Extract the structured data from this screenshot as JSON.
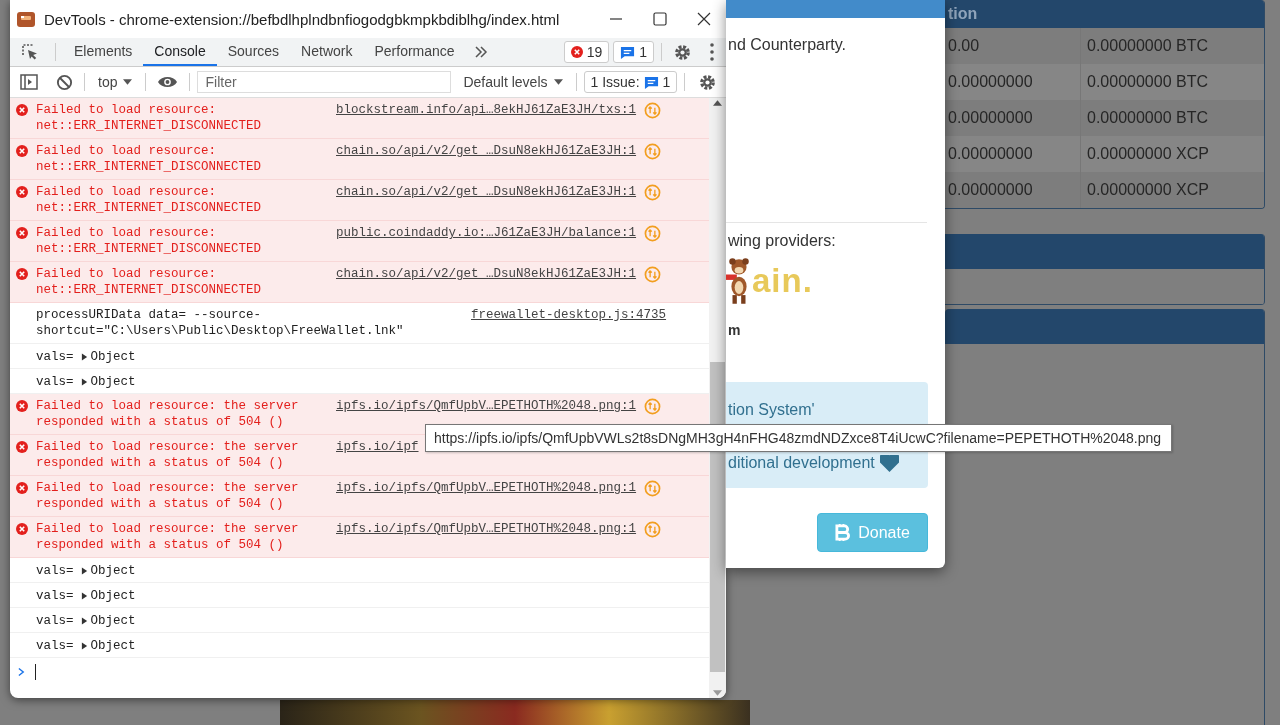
{
  "background": {
    "table": {
      "header": "tion",
      "rows": [
        {
          "amount": "0.00",
          "balance": "0.00000000 BTC"
        },
        {
          "amount": "0.00000000",
          "balance": "0.00000000 BTC"
        },
        {
          "amount": "0.00000000",
          "balance": "0.00000000 BTC"
        },
        {
          "amount": "0.00000000",
          "balance": "0.00000000 XCP"
        },
        {
          "amount": "0.00000000",
          "balance": "0.00000000 XCP"
        }
      ]
    }
  },
  "modal": {
    "intro": "nd Counterparty.",
    "providers_label": "wing providers:",
    "logo_text": "ain.",
    "provider_name": "m",
    "notice_lines": [
      "tion System'",
      "ditional development"
    ],
    "donate": "Donate"
  },
  "devtools": {
    "title": "DevTools - chrome-extension://befbdlhplndbnfiogodgbkmpkbdiblhg/index.html",
    "tabs": [
      {
        "label": "Elements",
        "selected": false
      },
      {
        "label": "Console",
        "selected": true
      },
      {
        "label": "Sources",
        "selected": false
      },
      {
        "label": "Network",
        "selected": false
      },
      {
        "label": "Performance",
        "selected": false
      }
    ],
    "error_count": "19",
    "message_count": "1",
    "context": "top",
    "filter": {
      "placeholder": "Filter"
    },
    "levels": "Default levels",
    "issues": {
      "label": "1 Issue:",
      "count": "1"
    },
    "messages": [
      {
        "kind": "error",
        "text": "Failed to load resource: net::ERR_INTERNET_DISCONNECTED",
        "source": "blockstream.info/api…8ekHJ61ZaE3JH/txs:1",
        "issue_icon": true
      },
      {
        "kind": "error",
        "text": "Failed to load resource: net::ERR_INTERNET_DISCONNECTED",
        "source": "chain.so/api/v2/get_…DsuN8ekHJ61ZaE3JH:1",
        "issue_icon": true
      },
      {
        "kind": "error",
        "text": "Failed to load resource: net::ERR_INTERNET_DISCONNECTED",
        "source": "chain.so/api/v2/get_…DsuN8ekHJ61ZaE3JH:1",
        "issue_icon": true
      },
      {
        "kind": "error",
        "text": "Failed to load resource: net::ERR_INTERNET_DISCONNECTED",
        "source": "public.coindaddy.io:…J61ZaE3JH/balance:1",
        "issue_icon": true
      },
      {
        "kind": "error",
        "text": "Failed to load resource: net::ERR_INTERNET_DISCONNECTED",
        "source": "chain.so/api/v2/get_…DsuN8ekHJ61ZaE3JH:1",
        "issue_icon": true
      },
      {
        "kind": "log",
        "text": "processURIData data= --source-shortcut=\"C:\\Users\\Public\\Desktop\\FreeWallet.lnk\"",
        "source": "freewallet-desktop.js:4735"
      },
      {
        "kind": "object",
        "label": "vals=",
        "value": "Object",
        "expanded": false
      },
      {
        "kind": "object",
        "label": "vals=",
        "value": "Object",
        "expanded": false
      },
      {
        "kind": "error",
        "text": "Failed to load resource: the server responded with a status of 504 ()",
        "source": "ipfs.io/ipfs/QmfUpbV…EPETHOTH%2048.png:1",
        "issue_icon": true
      },
      {
        "kind": "error",
        "text": "Failed to load resource: the server responded with a status of 504 ()",
        "source": "ipfs.io/ipf",
        "issue_icon": false
      },
      {
        "kind": "error",
        "text": "Failed to load resource: the server responded with a status of 504 ()",
        "source": "ipfs.io/ipfs/QmfUpbV…EPETHOTH%2048.png:1",
        "issue_icon": true
      },
      {
        "kind": "error",
        "text": "Failed to load resource: the server responded with a status of 504 ()",
        "source": "ipfs.io/ipfs/QmfUpbV…EPETHOTH%2048.png:1",
        "issue_icon": true
      },
      {
        "kind": "object",
        "label": "vals=",
        "value": "Object",
        "expanded": false
      },
      {
        "kind": "object",
        "label": "vals=",
        "value": "Object",
        "expanded": false
      },
      {
        "kind": "object",
        "label": "vals=",
        "value": "Object",
        "expanded": false
      },
      {
        "kind": "object",
        "label": "vals=",
        "value": "Object",
        "expanded": false
      }
    ]
  },
  "tooltip": {
    "url": "https://ipfs.io/ipfs/QmfUpbVWLs2t8sDNgMH3gH4nFHG48zmdNDZxce8T4iUcwC?filename=PEPETHOTH%2048.png"
  }
}
